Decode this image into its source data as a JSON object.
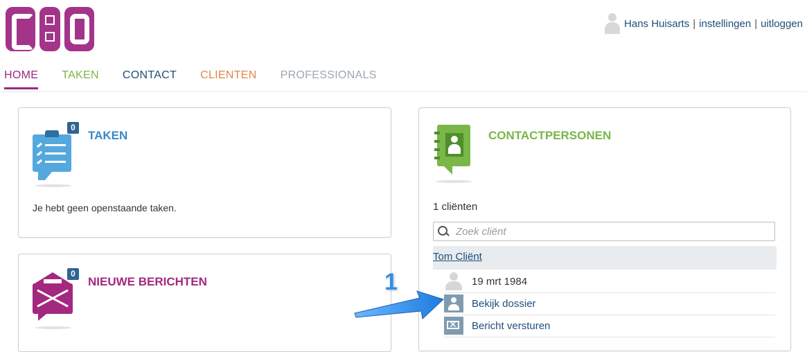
{
  "logo": {
    "text": "G:O"
  },
  "user": {
    "name": "Hans Huisarts",
    "separator": "|",
    "settings": "instellingen",
    "logout": "uitloggen"
  },
  "nav": {
    "tabs": [
      {
        "label": "HOME",
        "active": true
      },
      {
        "label": "TAKEN"
      },
      {
        "label": "CONTACT"
      },
      {
        "label": "CLIENTEN"
      },
      {
        "label": "PROFESSIONALS"
      }
    ]
  },
  "taken": {
    "title": "TAKEN",
    "badge": "0",
    "message": "Je hebt geen openstaande taken."
  },
  "berichten": {
    "title": "NIEUWE BERICHTEN",
    "badge": "0"
  },
  "contact": {
    "title": "CONTACTPERSONEN",
    "count": "1 cliënten",
    "search_placeholder": "Zoek cliënt",
    "client_name": "Tom Cliënt",
    "birthdate": "19 mrt 1984",
    "view_dossier": "Bekijk dossier",
    "send_message": "Bericht versturen"
  },
  "annotation": {
    "number": "1"
  },
  "colors": {
    "brand": "#a3348a",
    "taken": "#3a87c6",
    "contact_green": "#7ab648",
    "link_blue": "#1f4e79",
    "annotation_blue": "#2f8fe8"
  }
}
